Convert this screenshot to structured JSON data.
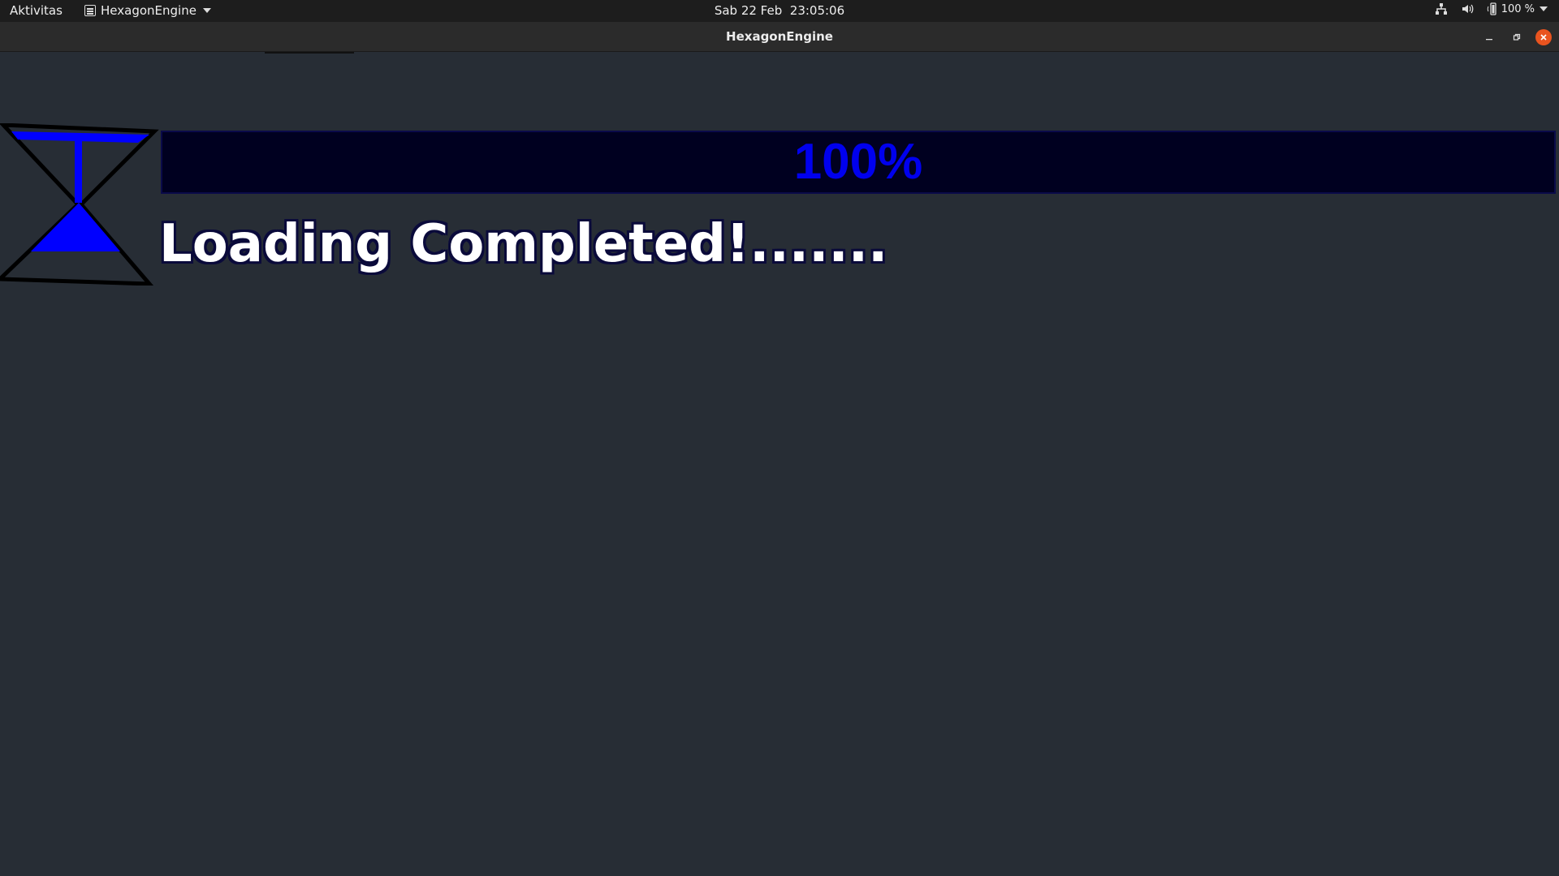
{
  "topbar": {
    "activities_label": "Aktivitas",
    "app_name": "HexagonEngine",
    "datetime": "Sab 22 Feb  23:05:06",
    "battery_level": "100 %",
    "icons": [
      "network-icon",
      "volume-icon",
      "battery-icon",
      "system-menu-caret-icon"
    ]
  },
  "window": {
    "title": "HexagonEngine",
    "controls": [
      "minimize-icon",
      "restore-icon",
      "close-icon"
    ],
    "close_color": "#e9541f"
  },
  "game": {
    "background_color": "#272d35",
    "progress": {
      "value": 1.0,
      "label": "100%",
      "text_color": "#0000ee",
      "bar_color": "#000020"
    },
    "status_text": "Loading Completed!.......",
    "hourglass": {
      "icon": "hourglass-icon",
      "fill_color": "#0000ff"
    }
  }
}
